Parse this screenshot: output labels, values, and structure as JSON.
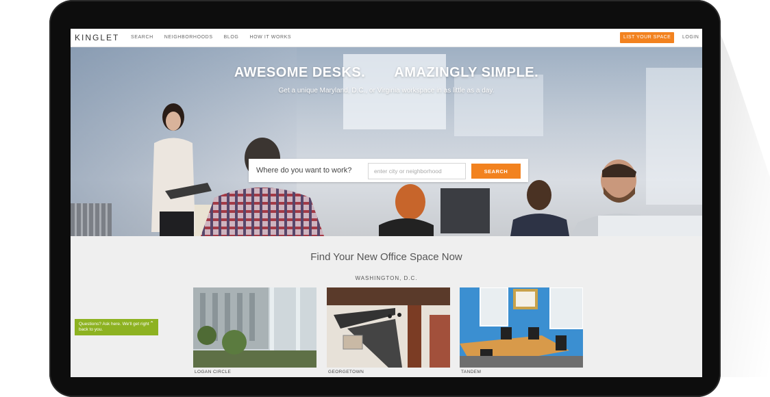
{
  "nav": {
    "logo": "KINGLET",
    "links": [
      "SEARCH",
      "NEIGHBORHOODS",
      "BLOG",
      "HOW IT WORKS"
    ],
    "list_button": "LIST YOUR SPACE",
    "login": "LOGIN"
  },
  "hero": {
    "title_left": "AWESOME DESKS.",
    "title_right": "AMAZINGLY SIMPLE.",
    "subtitle": "Get a unique Maryland, D.C., or Virginia workspace in as little as a day.",
    "search_label": "Where do you want to work?",
    "search_placeholder": "enter city or neighborhood",
    "search_button": "SEARCH"
  },
  "listings": {
    "heading": "Find Your New Office Space Now",
    "city": "WASHINGTON, D.C.",
    "cards": [
      {
        "name": "LOGAN CIRCLE"
      },
      {
        "name": "GEORGETOWN"
      },
      {
        "name": "TANDEM"
      }
    ]
  },
  "chat": {
    "text": "Questions? Ask here. We'll get right back to you."
  },
  "colors": {
    "accent": "#f2821f",
    "chat_bg": "#8db221"
  }
}
